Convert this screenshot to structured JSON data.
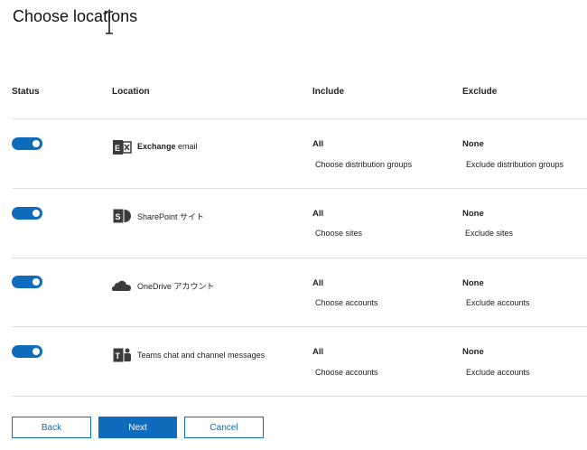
{
  "page": {
    "title": "Choose locations"
  },
  "table": {
    "headers": {
      "status": "Status",
      "location": "Location",
      "include": "Include",
      "exclude": "Exclude"
    },
    "rows": [
      {
        "status_on": true,
        "icon": "exchange-icon",
        "location_bold": "Exchange",
        "location_rest": " email",
        "include_value": "All",
        "include_link": "Choose distribution groups",
        "exclude_value": "None",
        "exclude_link": "Exclude distribution groups"
      },
      {
        "status_on": true,
        "icon": "sharepoint-icon",
        "location_bold": "",
        "location_rest": "SharePoint サイト",
        "include_value": "All",
        "include_link": "Choose sites",
        "exclude_value": "None",
        "exclude_link": "Exclude sites"
      },
      {
        "status_on": true,
        "icon": "onedrive-icon",
        "location_bold": "",
        "location_rest": "OneDrive アカウント",
        "include_value": "All",
        "include_link": "Choose accounts",
        "exclude_value": "None",
        "exclude_link": "Exclude accounts"
      },
      {
        "status_on": true,
        "icon": "teams-icon",
        "location_bold": "",
        "location_rest": "Teams chat and channel messages",
        "include_value": "All",
        "include_link": "Choose accounts",
        "exclude_value": "None",
        "exclude_link": "Exclude accounts"
      }
    ]
  },
  "buttons": {
    "back": "Back",
    "next": "Next",
    "cancel": "Cancel"
  },
  "colors": {
    "accent": "#0f6cbd",
    "divider": "#e1e1e1",
    "icon_dark": "#3b3b3b"
  }
}
